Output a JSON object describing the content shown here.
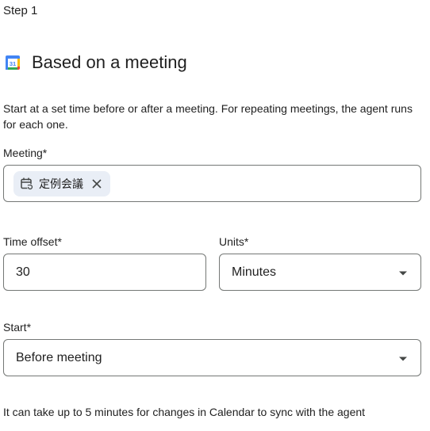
{
  "step_label": "Step 1",
  "section": {
    "icon": "google-calendar-icon",
    "title": "Based on a meeting",
    "description": "Start at a set time before or after a meeting. For repeating meetings, the agent runs for each one."
  },
  "meeting": {
    "label": "Meeting*",
    "chip": {
      "icon": "calendar-repeat-icon",
      "text": "定例会議",
      "remove_icon": "close-icon"
    }
  },
  "time_offset": {
    "label": "Time offset*",
    "value": "30"
  },
  "units": {
    "label": "Units*",
    "selected": "Minutes"
  },
  "start": {
    "label": "Start*",
    "selected": "Before meeting"
  },
  "footer_note": "It can take up to 5 minutes for changes in Calendar to sync with the agent",
  "colors": {
    "border": "#747775",
    "chip_bg": "#e9eef6",
    "text": "#1f1f1f"
  }
}
